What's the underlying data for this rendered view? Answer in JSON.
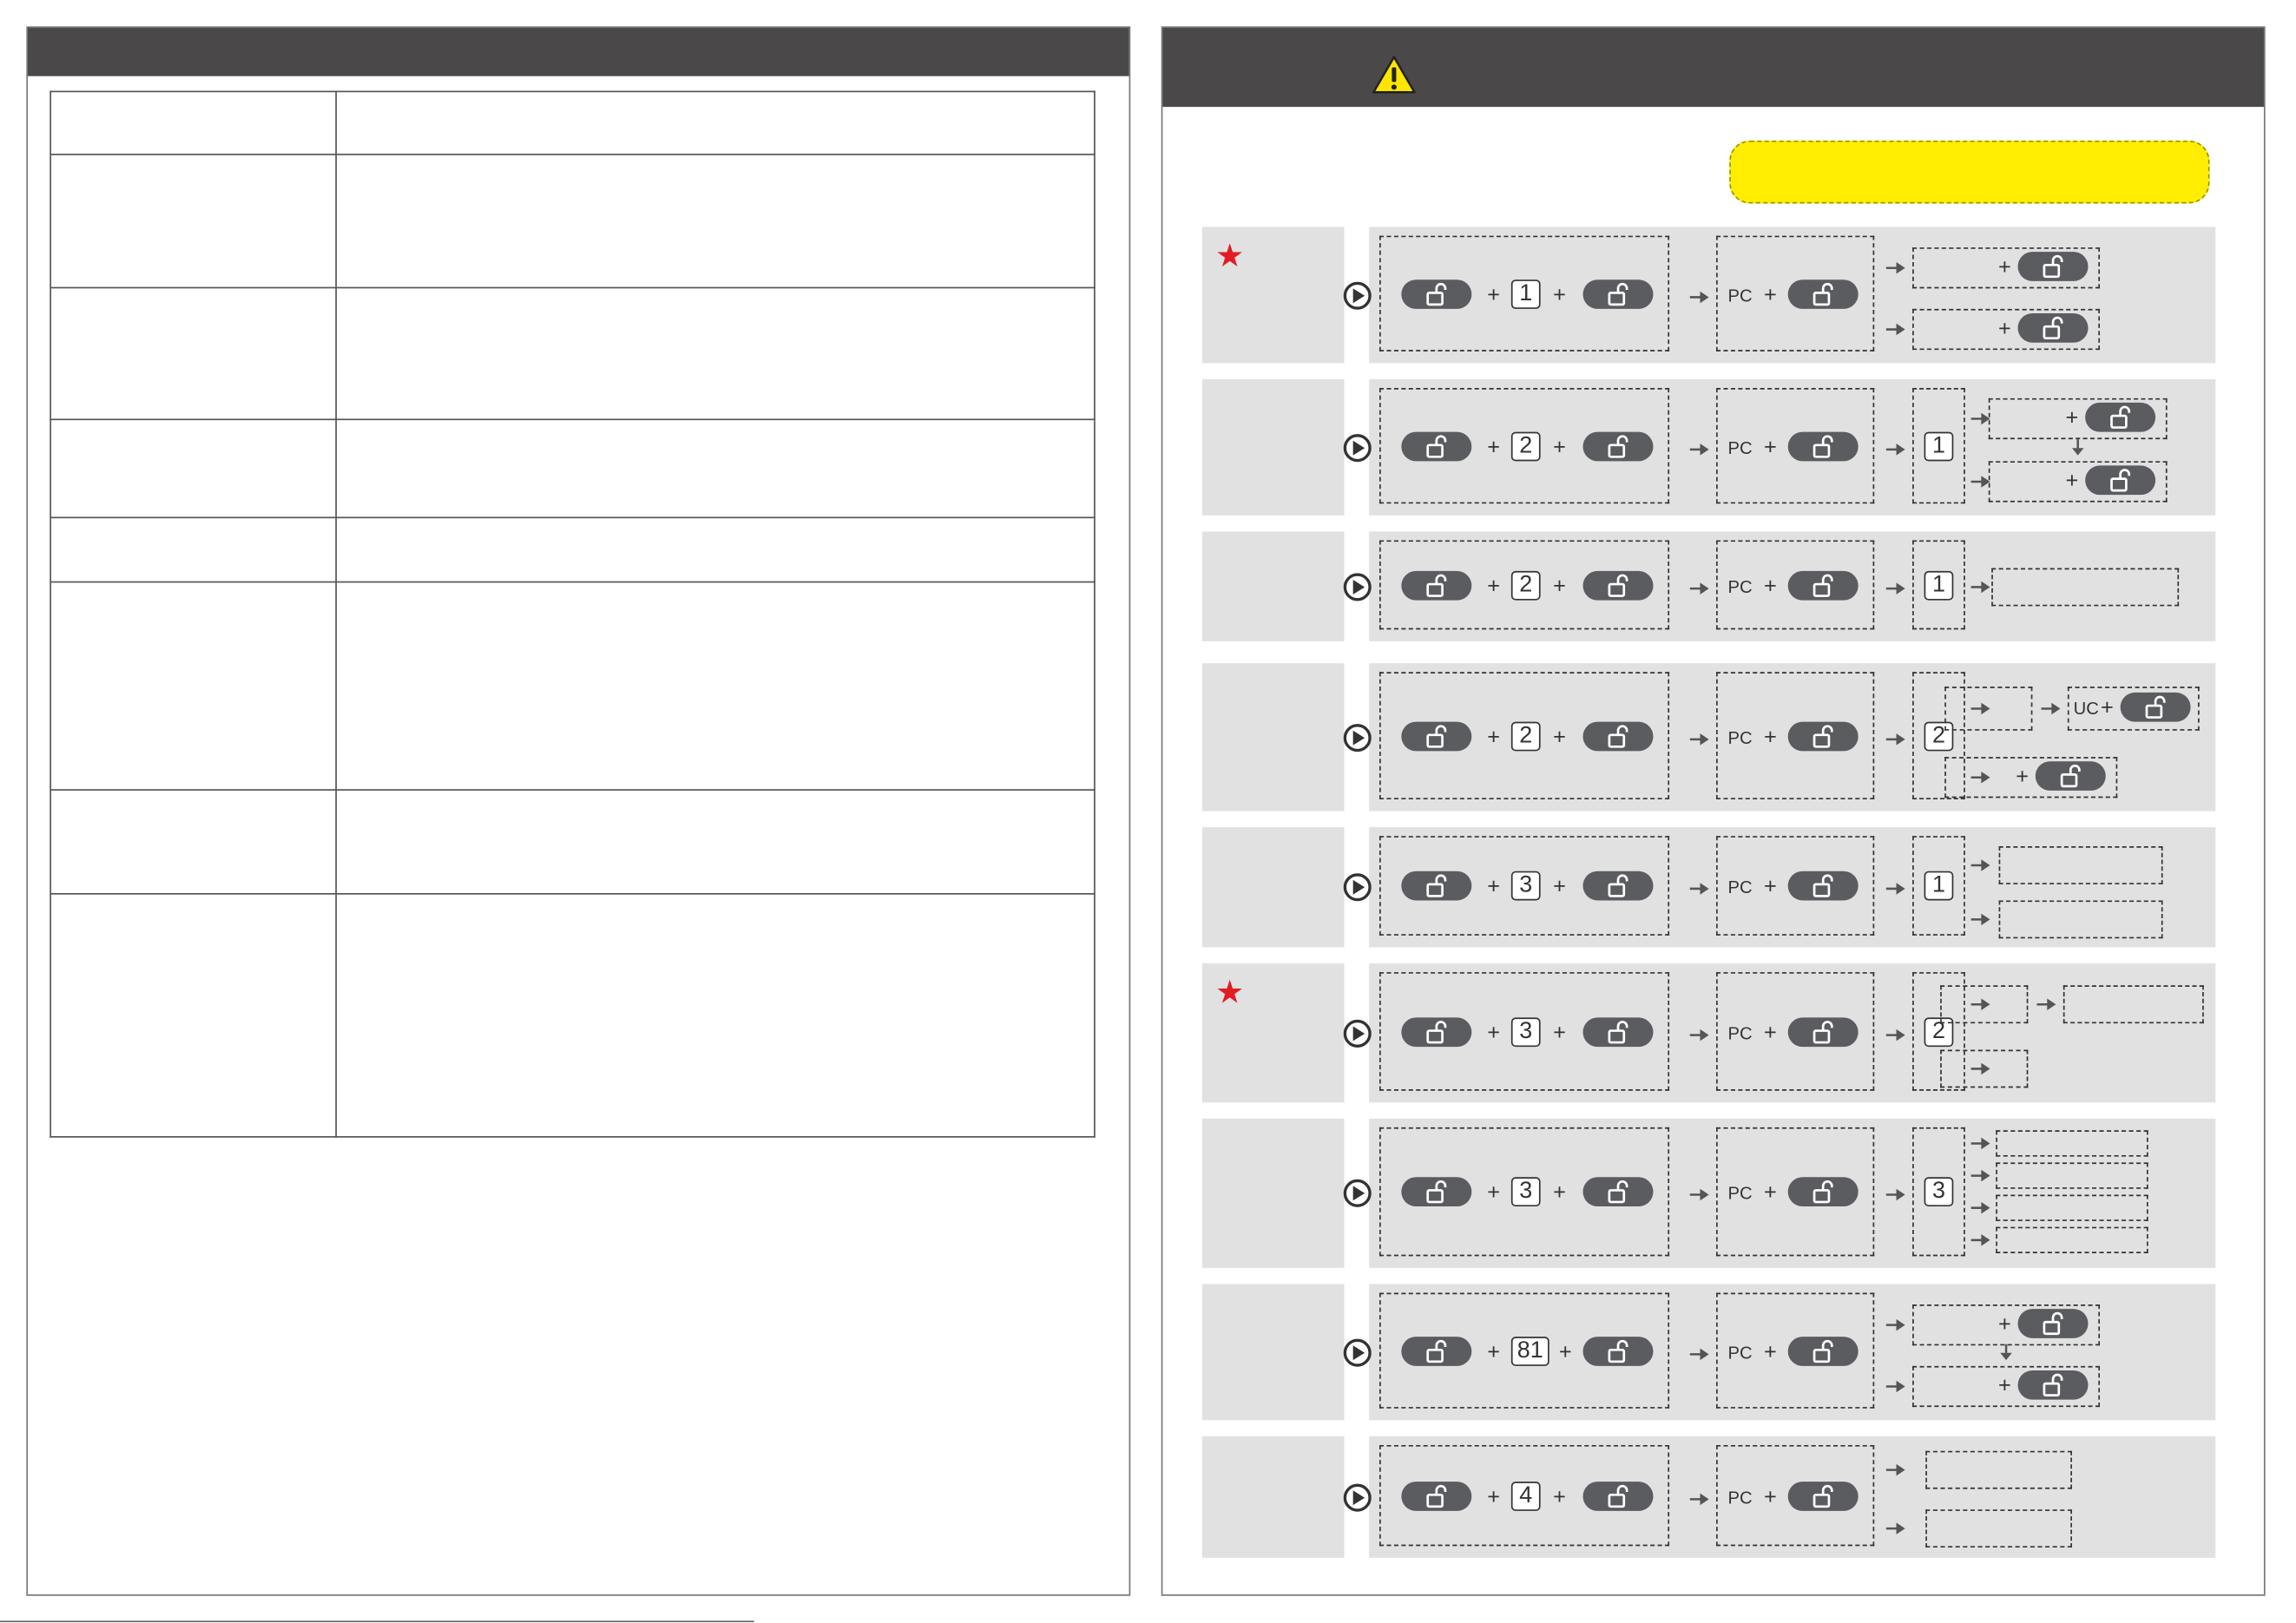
{
  "left_panel": {
    "header_text": "",
    "spec_table_rows": [
      {
        "label": "",
        "value": ""
      },
      {
        "label": "",
        "value": ""
      },
      {
        "label": "",
        "value": ""
      },
      {
        "label": "",
        "value": ""
      },
      {
        "label": "",
        "value": ""
      },
      {
        "label": "",
        "value": ""
      },
      {
        "label": "",
        "value": ""
      },
      {
        "label": "",
        "value": ""
      }
    ]
  },
  "right_panel": {
    "header_text": "",
    "warning_icon": "warning-triangle-icon",
    "highlight_note": "",
    "step_rows": [
      {
        "starred": true,
        "code": "1",
        "first_result": ""
      },
      {
        "starred": false,
        "code": "2",
        "first_result": "1"
      },
      {
        "starred": false,
        "code": "2",
        "first_result": "1"
      },
      {
        "starred": false,
        "code": "2",
        "first_result": "2"
      },
      {
        "starred": false,
        "code": "3",
        "first_result": "1"
      },
      {
        "starred": true,
        "code": "3",
        "first_result": "2"
      },
      {
        "starred": false,
        "code": "3",
        "first_result": "3"
      },
      {
        "starred": false,
        "code": "81",
        "first_result": ""
      },
      {
        "starred": false,
        "code": "4",
        "first_result": ""
      }
    ],
    "labels": {
      "plus": "+",
      "pc": "PC",
      "uc": "UC"
    }
  },
  "colors": {
    "header_bar": "#4a4848",
    "row_background": "#e1e1e1",
    "button": "#5a5c60",
    "highlight": "#ffee00",
    "star": "#e31b23"
  }
}
